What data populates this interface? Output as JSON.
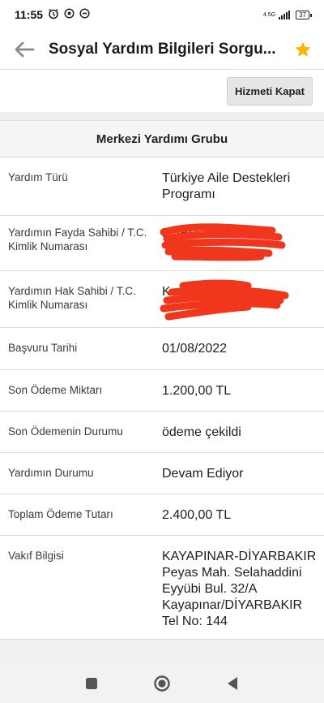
{
  "statusbar": {
    "time": "11:55",
    "network": "4.5G",
    "battery": "37"
  },
  "appbar": {
    "title": "Sosyal Yardım Bilgileri Sorgu..."
  },
  "actions": {
    "close_label": "Hizmeti Kapat"
  },
  "section": {
    "header": "Merkezi Yardımı Grubu",
    "rows": [
      {
        "label": "Yardım Türü",
        "value": "Türkiye Aile Destekleri Programı"
      },
      {
        "label": "Yardımın Fayda Sahibi / T.C. Kimlik Numarası",
        "value": "KÜBR"
      },
      {
        "label": "Yardımın Hak Sahibi / T.C. Kimlik Numarası",
        "value": "K"
      },
      {
        "label": "Başvuru Tarihi",
        "value": "01/08/2022"
      },
      {
        "label": "Son Ödeme Miktarı",
        "value": "1.200,00 TL"
      },
      {
        "label": "Son Ödemenin Durumu",
        "value": "ödeme çekildi"
      },
      {
        "label": "Yardımın Durumu",
        "value": "Devam Ediyor"
      },
      {
        "label": "Toplam Ödeme Tutarı",
        "value": "2.400,00 TL"
      },
      {
        "label": "Vakıf Bilgisi",
        "value": "KAYAPINAR-DİYARBAKIR Peyas Mah. Selahaddini Eyyübi Bul. 32/A Kayapınar/DİYARBAKIR Tel No: 144"
      }
    ]
  },
  "colors": {
    "star": "#f5b400",
    "redaction": "#f0361c"
  },
  "icons": [
    "back-arrow-icon",
    "star-icon",
    "alarm-icon",
    "sync-icon",
    "dnd-icon",
    "signal-icon",
    "battery-icon",
    "square-nav-icon",
    "home-nav-icon",
    "back-nav-icon"
  ]
}
